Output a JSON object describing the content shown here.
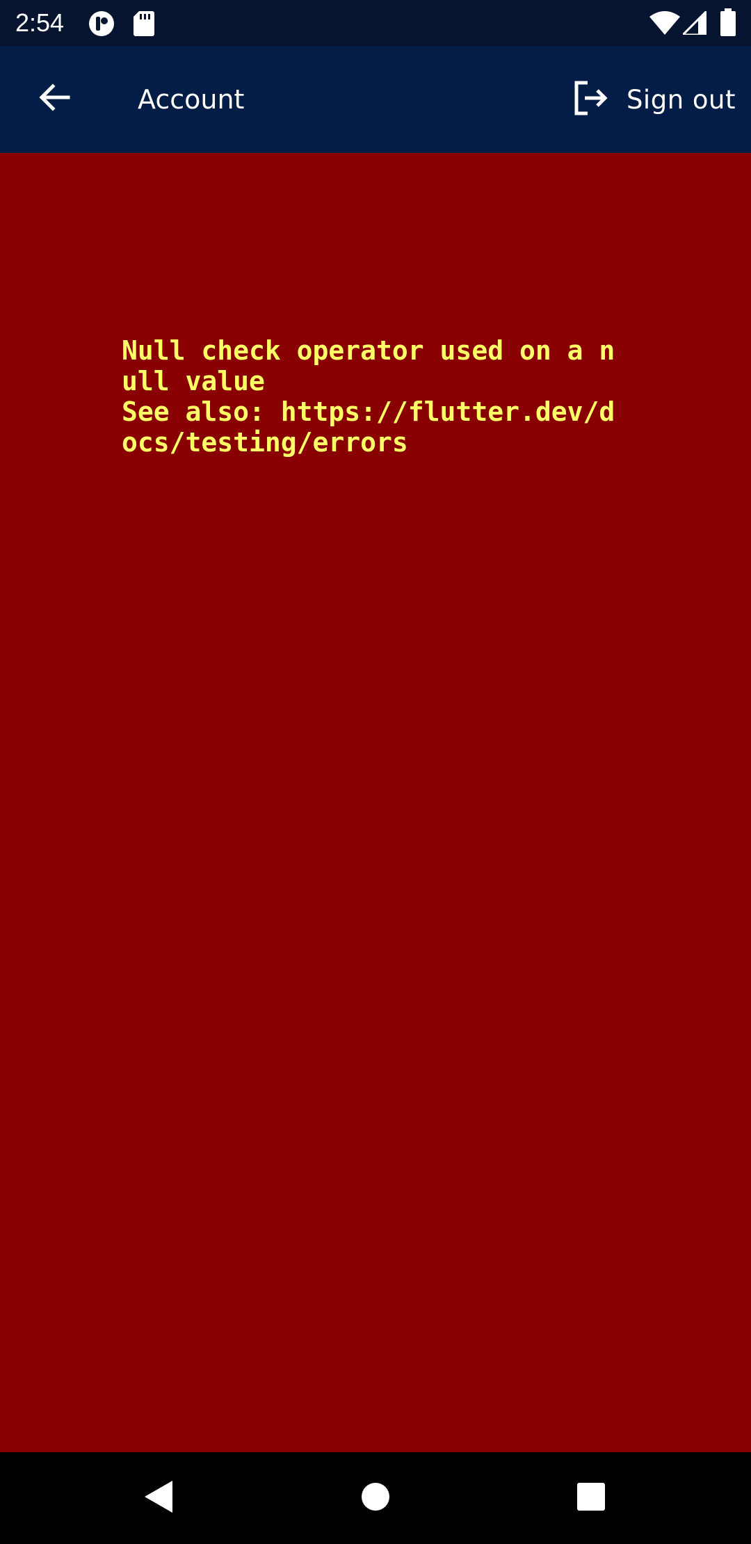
{
  "status_bar": {
    "time": "2:54",
    "icons": [
      "app-notification-icon",
      "sd-card-icon",
      "wifi-icon",
      "cellular-signal-icon",
      "battery-icon"
    ]
  },
  "app_bar": {
    "back_icon": "arrow-left-icon",
    "title": "Account",
    "sign_out_icon": "logout-icon",
    "sign_out_label": "Sign out",
    "background_color": "#041d46"
  },
  "error": {
    "message": "Null check operator used on a null value\nSee also: https://flutter.dev/docs/testing/errors",
    "background_color": "#880000",
    "text_color": "#ffff66"
  },
  "nav_bar": {
    "buttons": [
      "back-triangle-icon",
      "home-circle-icon",
      "recents-square-icon"
    ]
  }
}
